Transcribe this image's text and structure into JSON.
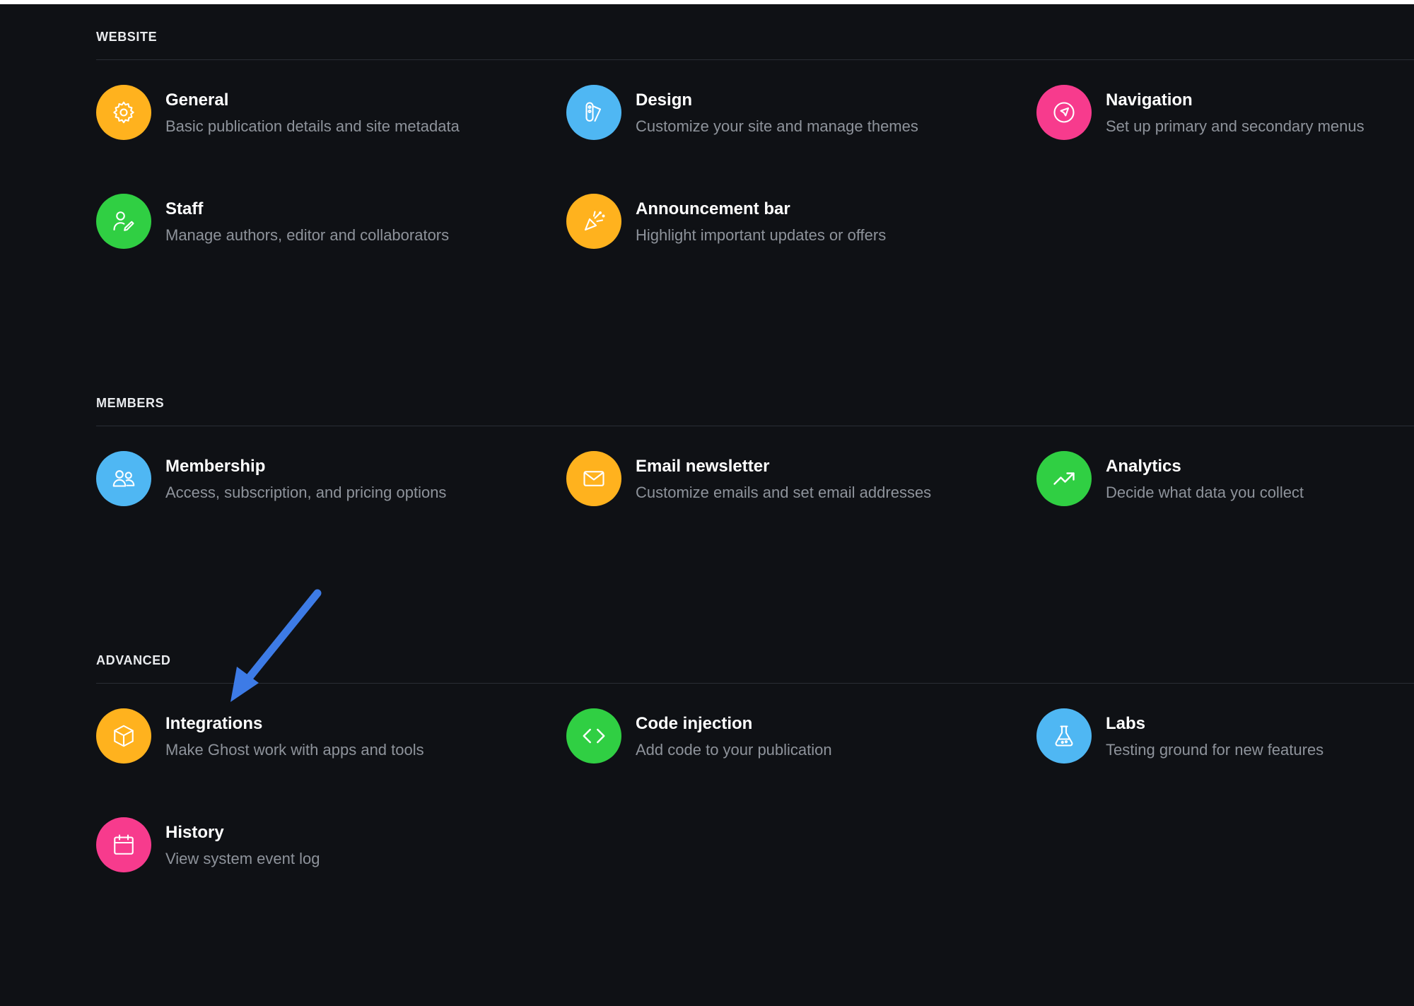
{
  "colors": {
    "yellow": "#ffb21e",
    "blue": "#4fb7f3",
    "pink": "#f73b8d",
    "green": "#30cf43",
    "arrow": "#3d7be6"
  },
  "website": {
    "title": "WEBSITE",
    "items": [
      {
        "title": "General",
        "desc": "Basic publication details and site metadata",
        "icon": "gear-icon"
      },
      {
        "title": "Design",
        "desc": "Customize your site and manage themes",
        "icon": "brush-icon"
      },
      {
        "title": "Navigation",
        "desc": "Set up primary and secondary menus",
        "icon": "compass-icon"
      },
      {
        "title": "Staff",
        "desc": "Manage authors, editor and collaborators",
        "icon": "user-edit-icon"
      },
      {
        "title": "Announcement bar",
        "desc": "Highlight important updates or offers",
        "icon": "party-popper-icon"
      }
    ]
  },
  "members": {
    "title": "MEMBERS",
    "items": [
      {
        "title": "Membership",
        "desc": "Access, subscription, and pricing options",
        "icon": "users-icon"
      },
      {
        "title": "Email newsletter",
        "desc": "Customize emails and set email addresses",
        "icon": "envelope-icon"
      },
      {
        "title": "Analytics",
        "desc": "Decide what data you collect",
        "icon": "trend-up-icon"
      }
    ]
  },
  "advanced": {
    "title": "ADVANCED",
    "items": [
      {
        "title": "Integrations",
        "desc": "Make Ghost work with apps and tools",
        "icon": "box-icon"
      },
      {
        "title": "Code injection",
        "desc": "Add code to your publication",
        "icon": "code-icon"
      },
      {
        "title": "Labs",
        "desc": "Testing ground for new features",
        "icon": "flask-icon"
      },
      {
        "title": "History",
        "desc": "View system event log",
        "icon": "calendar-icon"
      }
    ]
  }
}
